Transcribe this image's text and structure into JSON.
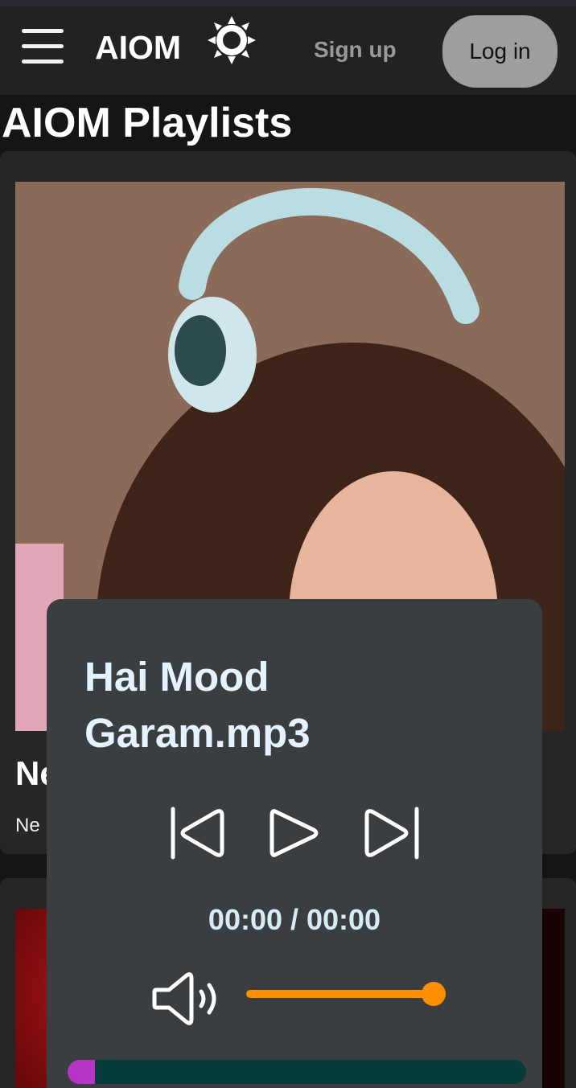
{
  "navbar": {
    "brand": "AIOM",
    "signup_label": "Sign up",
    "login_label": "Log in",
    "icons": [
      "menu-icon",
      "sun-icon"
    ]
  },
  "page": {
    "title": "AIOM Playlists"
  },
  "playlists": [
    {
      "title": "Ne",
      "subtitle": "Ne"
    }
  ],
  "player": {
    "song_title": "Hai Mood Garam.mp3",
    "time": "00:00 / 00:00",
    "volume": 0.97,
    "progress": 0.06,
    "colors": {
      "accent": "#ff8f00",
      "progress": "#b834c4",
      "track": "#073b3a",
      "title": "#e4f3ff"
    },
    "icons": [
      "skip-back-icon",
      "play-icon",
      "skip-forward-icon",
      "volume-icon"
    ]
  }
}
